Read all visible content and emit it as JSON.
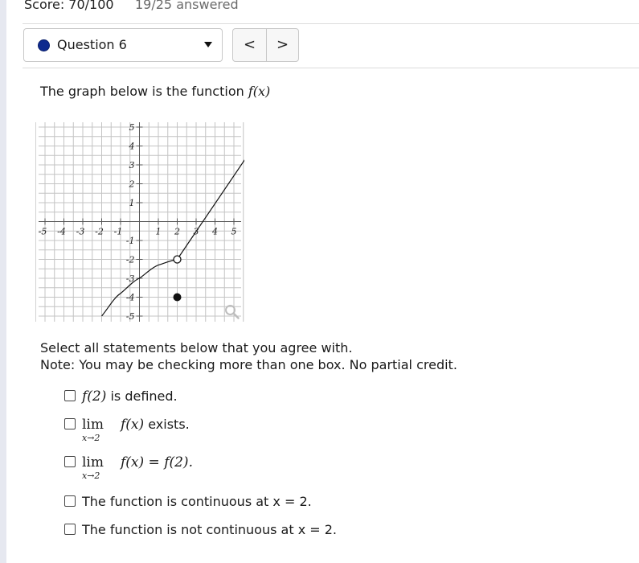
{
  "header": {
    "score": "Score: 70/100",
    "answered": "19/25 answered"
  },
  "question_nav": {
    "selected": "Question 6",
    "prev_icon": "chevron-left-icon",
    "next_icon": "chevron-right-icon",
    "prev_glyph": "<",
    "next_glyph": ">"
  },
  "prompt": {
    "text": "The graph below is the function ",
    "fx": "f(x)"
  },
  "graph": {
    "x_ticks": [
      "-5",
      "-4",
      "-3",
      "-2",
      "-1",
      "1",
      "2",
      "3",
      "4",
      "5"
    ],
    "y_ticks": [
      "5",
      "4",
      "3",
      "2",
      "1",
      "-1",
      "-2",
      "-3",
      "-4",
      "-5"
    ],
    "xlim": [
      -5,
      5
    ],
    "ylim": [
      -5,
      5
    ],
    "grid": true,
    "curve_left": {
      "kind": "curve",
      "x": [
        -2,
        -1,
        0,
        1,
        2
      ],
      "y": [
        -5,
        -3.8,
        -3,
        -2.3,
        -2
      ]
    },
    "line_right": {
      "kind": "line",
      "x": [
        2,
        6
      ],
      "y": [
        -2,
        3.9
      ]
    },
    "open_point": {
      "x": 2,
      "y": -2
    },
    "closed_point": {
      "x": 2,
      "y": -4
    },
    "icon": "magnify-icon"
  },
  "instructions": {
    "line1": "Select all statements below that you agree with.",
    "line2": "Note: You may be checking more than one box. No partial credit."
  },
  "options": {
    "o1": {
      "math": "f(2)",
      "text": " is defined."
    },
    "o2": {
      "lim": "lim",
      "sub": "x→2",
      "math": "f(x)",
      "text": " exists."
    },
    "o3": {
      "lim": "lim",
      "sub": "x→2",
      "math": "f(x) = f(2)."
    },
    "o4": {
      "text": "The function is continuous at x = 2."
    },
    "o5": {
      "text": "The function is not continuous at x = 2."
    }
  }
}
